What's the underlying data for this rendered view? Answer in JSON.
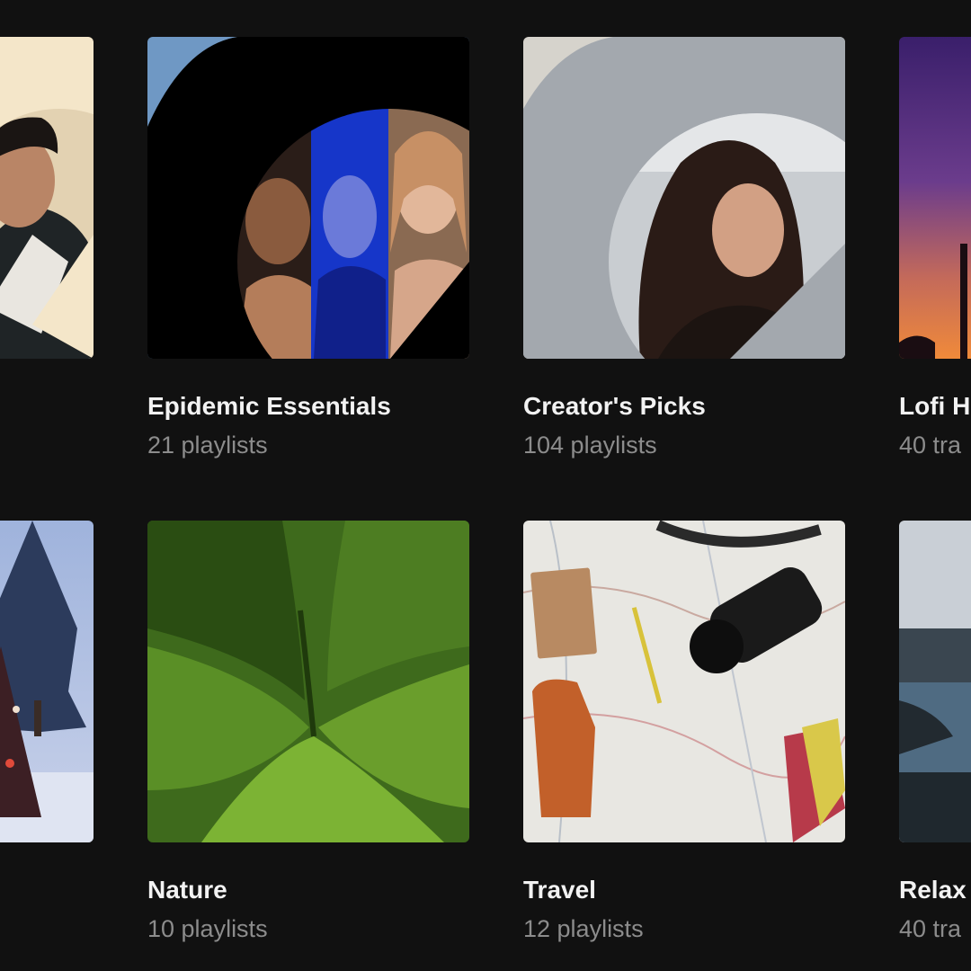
{
  "colors": {
    "background": "#111111",
    "title": "#f2f2f2",
    "meta": "#8c8c8c"
  },
  "rows": [
    [
      {
        "title": "",
        "meta": "",
        "art": "cream-portrait-man"
      },
      {
        "title": "Epidemic Essentials",
        "meta": "21 playlists",
        "art": "black-trio-portraits"
      },
      {
        "title": "Creator's Picks",
        "meta": "104 playlists",
        "art": "gray-portrait-woman"
      },
      {
        "title": "Lofi H",
        "meta": "40 tra",
        "art": "purple-sunset"
      }
    ],
    [
      {
        "title": "",
        "meta": "",
        "art": "snowy-tree"
      },
      {
        "title": "Nature",
        "meta": "10 playlists",
        "art": "green-moss-valley"
      },
      {
        "title": "Travel",
        "meta": "12 playlists",
        "art": "map-camera-flatlay"
      },
      {
        "title": "Relax",
        "meta": "40 tra",
        "art": "water-shoreline"
      }
    ]
  ]
}
